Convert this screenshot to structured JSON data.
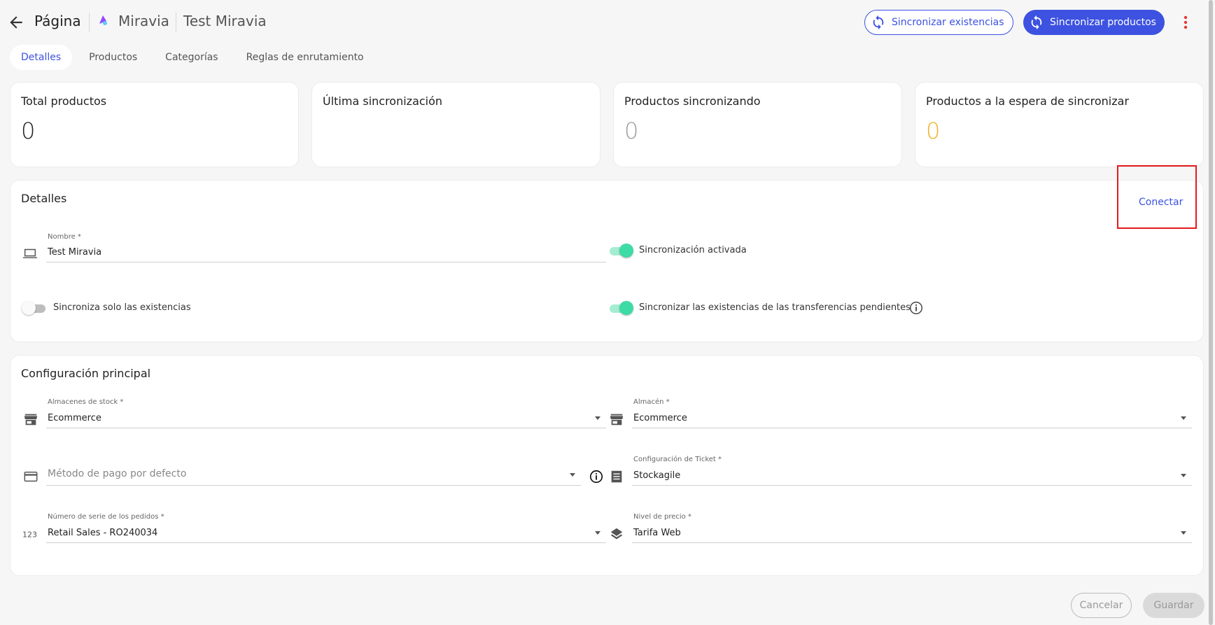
{
  "header": {
    "breadcrumb_page": "Página",
    "channel": "Miravia",
    "store_name": "Test Miravia",
    "sync_stock_label": "Sincronizar existencias",
    "sync_products_label": "Sincronizar productos"
  },
  "tabs": [
    {
      "label": "Detalles",
      "active": true
    },
    {
      "label": "Productos",
      "active": false
    },
    {
      "label": "Categorías",
      "active": false
    },
    {
      "label": "Reglas de enrutamiento",
      "active": false
    }
  ],
  "stats": [
    {
      "title": "Total productos",
      "value": "0",
      "color": "#222222"
    },
    {
      "title": "Última sincronización",
      "value": "",
      "color": "#222222"
    },
    {
      "title": "Productos sincronizando",
      "value": "0",
      "color": "#9e9e9e"
    },
    {
      "title": "Productos a la espera de sincronizar",
      "value": "0",
      "color": "#f0b429"
    }
  ],
  "details": {
    "title": "Detalles",
    "connect_label": "Conectar",
    "name_label": "Nombre *",
    "name_value": "Test Miravia",
    "sync_enabled_label": "Sincronización activada",
    "sync_enabled": true,
    "stock_only_label": "Sincroniza solo las existencias",
    "stock_only": false,
    "pending_transfers_label": "Sincronizar las existencias de las transferencias pendientes",
    "pending_transfers": true
  },
  "config": {
    "title": "Configuración principal",
    "stock_warehouses_label": "Almacenes de stock *",
    "stock_warehouses_value": "Ecommerce",
    "warehouse_label": "Almacén *",
    "warehouse_value": "Ecommerce",
    "payment_placeholder": "Método de pago por defecto",
    "ticket_config_label": "Configuración de Ticket *",
    "ticket_config_value": "Stockagile",
    "order_series_label": "Número de serie de los pedidos *",
    "order_series_value": "Retail Sales - RO240034",
    "price_level_label": "Nivel de precio *",
    "price_level_value": "Tarifa Web"
  },
  "footer": {
    "cancel_label": "Cancelar",
    "save_label": "Guardar"
  },
  "colors": {
    "accent": "#3d52e0",
    "toggle_on": "#3ddba6",
    "highlight": "#e41b1b"
  }
}
